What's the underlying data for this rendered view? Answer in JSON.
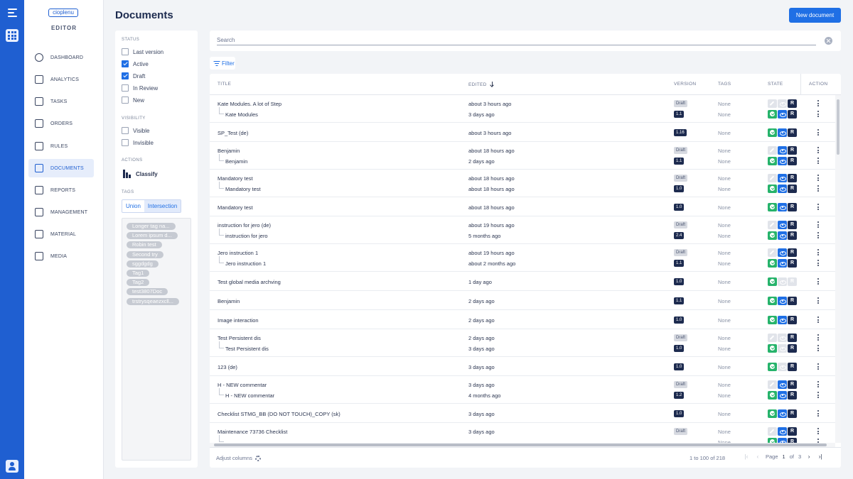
{
  "app": {
    "logo": "cioplenu",
    "section": "EDITOR"
  },
  "nav": [
    {
      "label": "DASHBOARD",
      "icon": "pie-chart-icon"
    },
    {
      "label": "ANALYTICS",
      "icon": "line-chart-icon"
    },
    {
      "label": "TASKS",
      "icon": "checklist-icon"
    },
    {
      "label": "ORDERS",
      "icon": "calendar-check-icon"
    },
    {
      "label": "RULES",
      "icon": "calendar-icon"
    },
    {
      "label": "DOCUMENTS",
      "icon": "document-icon",
      "active": true
    },
    {
      "label": "REPORTS",
      "icon": "copy-icon"
    },
    {
      "label": "MANAGEMENT",
      "icon": "table-icon"
    },
    {
      "label": "MATERIAL",
      "icon": "wrench-icon"
    },
    {
      "label": "MEDIA",
      "icon": "images-icon"
    }
  ],
  "header": {
    "title": "Documents",
    "new_document": "New document"
  },
  "filters": {
    "status_heading": "STATUS",
    "status": [
      {
        "label": "Last version",
        "checked": false
      },
      {
        "label": "Active",
        "checked": true
      },
      {
        "label": "Draft",
        "checked": true
      },
      {
        "label": "In Review",
        "checked": false
      },
      {
        "label": "New",
        "checked": false
      }
    ],
    "visibility_heading": "VISIBILITY",
    "visibility": [
      {
        "label": "Visible",
        "checked": false
      },
      {
        "label": "Invisible",
        "checked": false
      }
    ],
    "actions_heading": "ACTIONS",
    "classify": "Classify",
    "tags_heading": "TAGS",
    "union": "Union",
    "intersection": "Intersection",
    "tags": [
      "Longer tag na...",
      "Lorem ipsum d...",
      "Robin test",
      "Second try",
      "sggdgdg",
      "Tag1",
      "Tag2",
      "test3807Doc",
      "trstrysqeaezxcll..."
    ]
  },
  "search": {
    "placeholder": "Search",
    "value": ""
  },
  "filter_button": "Filter",
  "table": {
    "columns": {
      "title": "TITLE",
      "edited": "EDITED",
      "version": "VERSION",
      "tags": "TAGS",
      "state": "STATE",
      "action": "ACTION"
    },
    "rows": [
      {
        "lines": [
          {
            "title": "Kate Modules. A lot of Step",
            "edited": "about 3 hours ago",
            "version": "Draft",
            "tags": "None",
            "state": [
              "pen",
              "eye-off",
              "r"
            ]
          },
          {
            "title": "Kate Modules",
            "sub": true,
            "edited": "3 days ago",
            "version": "1.1",
            "tags": "None",
            "state": [
              "ok",
              "eye",
              "r"
            ]
          }
        ]
      },
      {
        "lines": [
          {
            "title": "SP_Test (de)",
            "edited": "about 3 hours ago",
            "version": "1.16",
            "tags": "None",
            "state": [
              "ok",
              "eye",
              "r"
            ]
          }
        ]
      },
      {
        "lines": [
          {
            "title": "Benjamin",
            "edited": "about 18 hours ago",
            "version": "Draft",
            "tags": "None",
            "state": [
              "pen",
              "eye",
              "r"
            ]
          },
          {
            "title": "Benjamin",
            "sub": true,
            "edited": "2 days ago",
            "version": "1.1",
            "tags": "None",
            "state": [
              "ok",
              "eye",
              "r"
            ]
          }
        ]
      },
      {
        "lines": [
          {
            "title": "Mandatory test",
            "edited": "about 18 hours ago",
            "version": "Draft",
            "tags": "None",
            "state": [
              "pen",
              "eye",
              "r"
            ]
          },
          {
            "title": "Mandatory test",
            "sub": true,
            "edited": "about 18 hours ago",
            "version": "1.0",
            "tags": "None",
            "state": [
              "ok",
              "eye",
              "r"
            ]
          }
        ]
      },
      {
        "lines": [
          {
            "title": "Mandatory test",
            "edited": "about 18 hours ago",
            "version": "1.0",
            "tags": "None",
            "state": [
              "ok",
              "eye",
              "r"
            ]
          }
        ]
      },
      {
        "lines": [
          {
            "title": "instruction for jero (de)",
            "edited": "about 19 hours ago",
            "version": "Draft",
            "tags": "None",
            "state": [
              "pen",
              "eye",
              "r"
            ]
          },
          {
            "title": "instruction for jero",
            "sub": true,
            "edited": "5 months ago",
            "version": "2.4",
            "tags": "None",
            "state": [
              "ok",
              "eye",
              "r"
            ]
          }
        ]
      },
      {
        "lines": [
          {
            "title": "Jero instruction 1",
            "edited": "about 19 hours ago",
            "version": "Draft",
            "tags": "None",
            "state": [
              "pen",
              "eye",
              "r"
            ]
          },
          {
            "title": "Jero instruction 1",
            "sub": true,
            "edited": "about 2 months ago",
            "version": "1.1",
            "tags": "None",
            "state": [
              "ok",
              "eye",
              "r"
            ]
          }
        ]
      },
      {
        "lines": [
          {
            "title": "Test global media archving",
            "edited": "1 day ago",
            "version": "1.0",
            "tags": "None",
            "state": [
              "ok",
              "eye-off",
              "r-off"
            ]
          }
        ]
      },
      {
        "lines": [
          {
            "title": "Benjamin",
            "edited": "2 days ago",
            "version": "1.1",
            "tags": "None",
            "state": [
              "ok",
              "eye",
              "r"
            ]
          }
        ]
      },
      {
        "lines": [
          {
            "title": "Image interaction",
            "edited": "2 days ago",
            "version": "1.0",
            "tags": "None",
            "state": [
              "ok",
              "eye",
              "r"
            ]
          }
        ]
      },
      {
        "lines": [
          {
            "title": "Test Persistent dis",
            "edited": "2 days ago",
            "version": "Draft",
            "tags": "None",
            "state": [
              "pen",
              "eye-off",
              "r"
            ]
          },
          {
            "title": "Test Persistent dis",
            "sub": true,
            "edited": "3 days ago",
            "version": "1.0",
            "tags": "None",
            "state": [
              "ok",
              "eye-off",
              "r"
            ]
          }
        ]
      },
      {
        "lines": [
          {
            "title": "123 (de)",
            "edited": "3 days ago",
            "version": "1.0",
            "tags": "None",
            "state": [
              "ok",
              "eye-off",
              "r"
            ]
          }
        ]
      },
      {
        "lines": [
          {
            "title": "H - NEW commentar",
            "edited": "3 days ago",
            "version": "Draft",
            "tags": "None",
            "state": [
              "pen",
              "eye",
              "r"
            ]
          },
          {
            "title": "H - NEW commentar",
            "sub": true,
            "edited": "4 months ago",
            "version": "1.2",
            "tags": "None",
            "state": [
              "ok",
              "eye",
              "r"
            ]
          }
        ]
      },
      {
        "lines": [
          {
            "title": "Checklist STMG_BB (DO NOT TOUCH)_COPY (sk)",
            "edited": "3 days ago",
            "version": "1.0",
            "tags": "None",
            "state": [
              "ok",
              "eye",
              "r"
            ]
          }
        ]
      },
      {
        "lines": [
          {
            "title": "Maintenance 73736 Checklist",
            "edited": "3 days ago",
            "version": "Draft",
            "tags": "None",
            "state": [
              "pen",
              "eye",
              "r"
            ]
          },
          {
            "title": "",
            "sub": true,
            "edited": "",
            "version": "",
            "tags": "None",
            "state": [
              "ok",
              "eye",
              "r"
            ]
          }
        ]
      }
    ]
  },
  "footer": {
    "adjust_columns": "Adjust columns",
    "range": "1 to 100 of 218",
    "page_label": "Page",
    "page": "1",
    "of_label": "of",
    "total_pages": "3"
  }
}
